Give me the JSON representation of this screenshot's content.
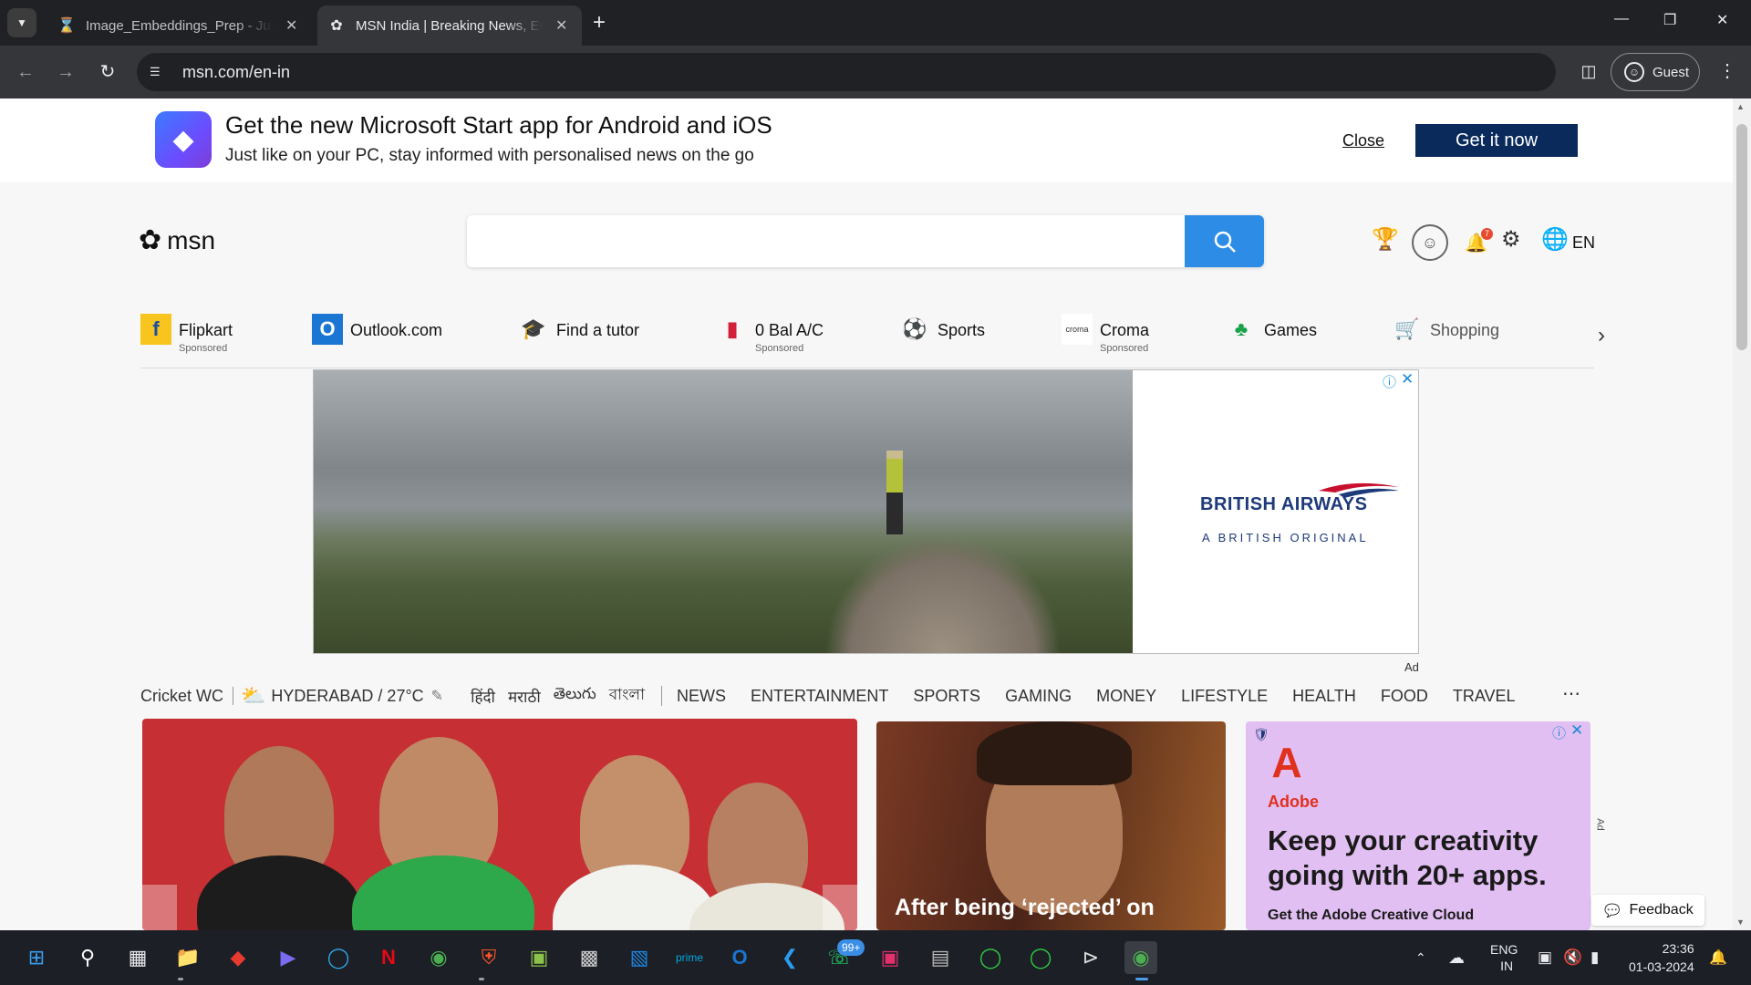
{
  "browser": {
    "tabs": [
      {
        "title": "Image_Embeddings_Prep - Jupyter",
        "icon": "hourglass-icon"
      },
      {
        "title": "MSN India | Breaking News, Entertainment",
        "icon": "msn-butterfly-icon",
        "active": true
      }
    ],
    "url": "msn.com/en-in",
    "profile_label": "Guest"
  },
  "banner": {
    "title": "Get the new Microsoft Start app for Android and iOS",
    "subtitle": "Just like on your PC, stay informed with personalised news on the go",
    "close_label": "Close",
    "cta_label": "Get it now"
  },
  "header": {
    "logo_text": "msn",
    "search_placeholder": "",
    "notification_count": "7",
    "language": "EN"
  },
  "quick_links": [
    {
      "label": "Flipkart",
      "sponsored": "Sponsored",
      "icon": "flipkart-icon",
      "color": "#f7c51d"
    },
    {
      "label": "Outlook.com",
      "sponsored": "",
      "icon": "outlook-icon",
      "color": "#1976d2"
    },
    {
      "label": "Find a tutor",
      "sponsored": "",
      "icon": "graduation-cap-icon",
      "color": "#1f4e79"
    },
    {
      "label": "0 Bal A/C",
      "sponsored": "Sponsored",
      "icon": "bank-icon",
      "color": "#d3203a"
    },
    {
      "label": "Sports",
      "sponsored": "",
      "icon": "sports-icon",
      "color": "#4b3fa8"
    },
    {
      "label": "Croma",
      "sponsored": "Sponsored",
      "icon": "croma-icon",
      "color": "#333333"
    },
    {
      "label": "Games",
      "sponsored": "",
      "icon": "cards-icon",
      "color": "#18a34a"
    },
    {
      "label": "Shopping",
      "sponsored": "",
      "icon": "cart-icon",
      "color": "#1e6fe0"
    }
  ],
  "ad": {
    "brand": "BRITISH AIRWAYS",
    "tagline": "A BRITISH ORIGINAL",
    "label": "Ad"
  },
  "category_nav": {
    "first": "Cricket WC",
    "weather": "HYDERABAD / 27°C",
    "languages": [
      "हिंदी",
      "मराठी",
      "తెలుగు",
      "বাংলা"
    ],
    "items": [
      "NEWS",
      "ENTERTAINMENT",
      "SPORTS",
      "GAMING",
      "MONEY",
      "LIFESTYLE",
      "HEALTH",
      "FOOD",
      "TRAVEL"
    ]
  },
  "cards": {
    "card2_title": "After being ‘rejected’ on",
    "adobe_brand": "Adobe",
    "adobe_headline": "Keep your creativity going with 20+ apps.",
    "adobe_sub": "Get the Adobe Creative Cloud",
    "ad_label": "Ad"
  },
  "feedback_label": "Feedback",
  "taskbar": {
    "whatsapp_badge": "99+",
    "lang_top": "ENG",
    "lang_bottom": "IN",
    "time": "23:36",
    "date": "01-03-2024"
  }
}
